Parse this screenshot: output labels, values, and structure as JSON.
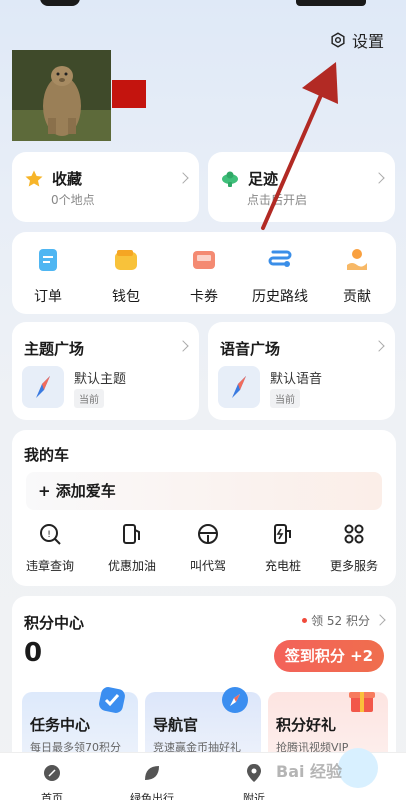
{
  "header": {
    "settings_label": "设置"
  },
  "favorites": {
    "title": "收藏",
    "subtitle": "0个地点"
  },
  "trail": {
    "title": "足迹",
    "subtitle": "点击后开启"
  },
  "quick_actions": [
    {
      "label": "订单",
      "icon": "order-icon"
    },
    {
      "label": "钱包",
      "icon": "wallet-icon"
    },
    {
      "label": "卡券",
      "icon": "coupon-icon"
    },
    {
      "label": "历史路线",
      "icon": "route-history-icon"
    },
    {
      "label": "贡献",
      "icon": "contribute-icon"
    }
  ],
  "theme_plaza": {
    "title": "主题广场",
    "item": "默认主题",
    "tag": "当前"
  },
  "voice_plaza": {
    "title": "语音广场",
    "item": "默认语音",
    "tag": "当前"
  },
  "my_car": {
    "title": "我的车",
    "add_label": "+ 添加爱车",
    "services": [
      {
        "label": "违章查询",
        "icon": "violation-search-icon"
      },
      {
        "label": "优惠加油",
        "icon": "fuel-icon"
      },
      {
        "label": "叫代驾",
        "icon": "steering-wheel-icon"
      },
      {
        "label": "充电桩",
        "icon": "charging-icon"
      },
      {
        "label": "更多服务",
        "icon": "more-services-icon"
      }
    ]
  },
  "points": {
    "title": "积分中心",
    "link": "领 52 积分",
    "value": "0",
    "checkin_label": "签到积分 +2",
    "tasks": [
      {
        "title": "任务中心",
        "subtitle": "每日最多领70积分"
      },
      {
        "title": "导航官",
        "subtitle": "竞速赢金币抽好礼"
      },
      {
        "title": "积分好礼",
        "subtitle": "抢腾讯视频VIP"
      }
    ]
  },
  "tabbar": [
    {
      "label": "首页",
      "icon": "home-icon"
    },
    {
      "label": "绿色出行",
      "icon": "leaf-icon"
    },
    {
      "label": "附近",
      "icon": "location-pin-icon"
    }
  ],
  "watermark": "Bai 经验",
  "colors": {
    "accent_red": "#F3625A",
    "annotation_arrow": "#B22A24"
  }
}
